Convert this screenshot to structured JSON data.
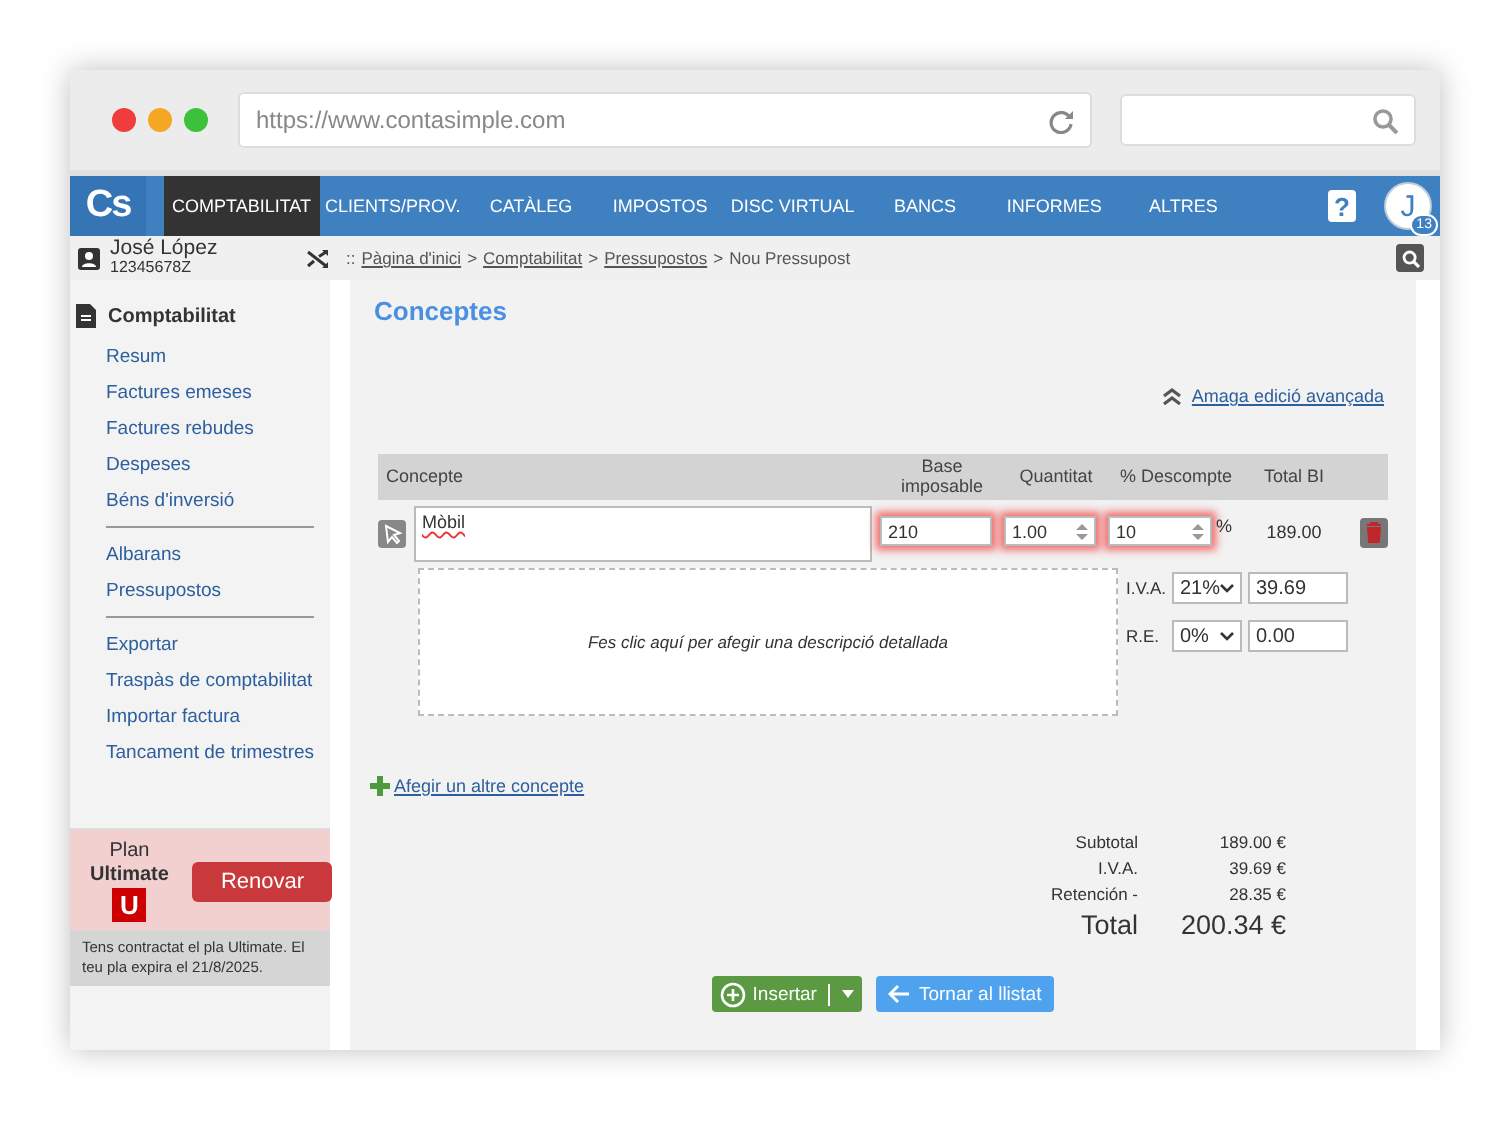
{
  "browser": {
    "url": "https://www.contasimple.com"
  },
  "nav": {
    "logo": "Cs",
    "items": [
      {
        "label": "COMPTABILITAT",
        "selected": true
      },
      {
        "label": "CLIENTS/PROV.",
        "selected": false
      },
      {
        "label": "CATÀLEG",
        "selected": false
      },
      {
        "label": "IMPOSTOS",
        "selected": false
      },
      {
        "label": "DISC VIRTUAL",
        "selected": false
      },
      {
        "label": "BANCS",
        "selected": false
      },
      {
        "label": "INFORMES",
        "selected": false
      },
      {
        "label": "ALTRES",
        "selected": false
      }
    ],
    "help": "?",
    "avatar": "J",
    "badge": "13"
  },
  "user": {
    "name": "José López",
    "id": "12345678Z"
  },
  "breadcrumb": {
    "prefix": "::",
    "links": [
      "Pàgina d'inici",
      "Comptabilitat",
      "Pressupostos"
    ],
    "separator": ">",
    "current": "Nou Pressupost"
  },
  "sidebar": {
    "heading": "Comptabilitat",
    "groups": [
      {
        "items": [
          "Resum",
          "Factures emeses",
          "Factures rebudes",
          "Despeses",
          "Béns d'inversió"
        ]
      },
      {
        "items": [
          "Albarans",
          "Pressupostos"
        ]
      },
      {
        "items": [
          "Exportar",
          "Traspàs de comptabilitat",
          "Importar factura",
          "Tancament de trimestres"
        ]
      }
    ]
  },
  "plan": {
    "label": "Plan",
    "name": "Ultimate",
    "badge": "U",
    "button": "Renovar",
    "note": "Tens contractat el pla Ultimate. El teu pla expira el 21/8/2025."
  },
  "concepts": {
    "title": "Conceptes",
    "toggle_link": "Amaga edició avançada",
    "columns": [
      "Concepte",
      "Base imposable",
      "Quantitat",
      "% Descompte",
      "Total BI"
    ],
    "rows": [
      {
        "concept": "Mòbil",
        "base": {
          "value": "210",
          "highlighted": true
        },
        "quantity": {
          "value": "1.00",
          "highlighted": true
        },
        "discount": {
          "value": "10",
          "highlighted": true
        },
        "discount_unit": "%",
        "total": "189.00",
        "description_placeholder": "Fes clic aquí per afegir una descripció detallada",
        "taxes": [
          {
            "label": "I.V.A.",
            "rate": "21%",
            "amount": "39.69"
          },
          {
            "label": "R.E.",
            "rate": "0%",
            "amount": "0.00"
          }
        ]
      }
    ],
    "add_link": "Afegir un altre concepte"
  },
  "totals": [
    {
      "kind": "line",
      "label": "Subtotal",
      "value": "189.00 €"
    },
    {
      "kind": "line",
      "label": "I.V.A.",
      "value": "39.69 €"
    },
    {
      "kind": "line",
      "label": "Retención -",
      "value": "28.35 €"
    },
    {
      "kind": "grand",
      "label": "Total",
      "value": "200.34 €"
    }
  ],
  "actions": {
    "insert": "Insertar",
    "back": "Tornar al llistat"
  }
}
